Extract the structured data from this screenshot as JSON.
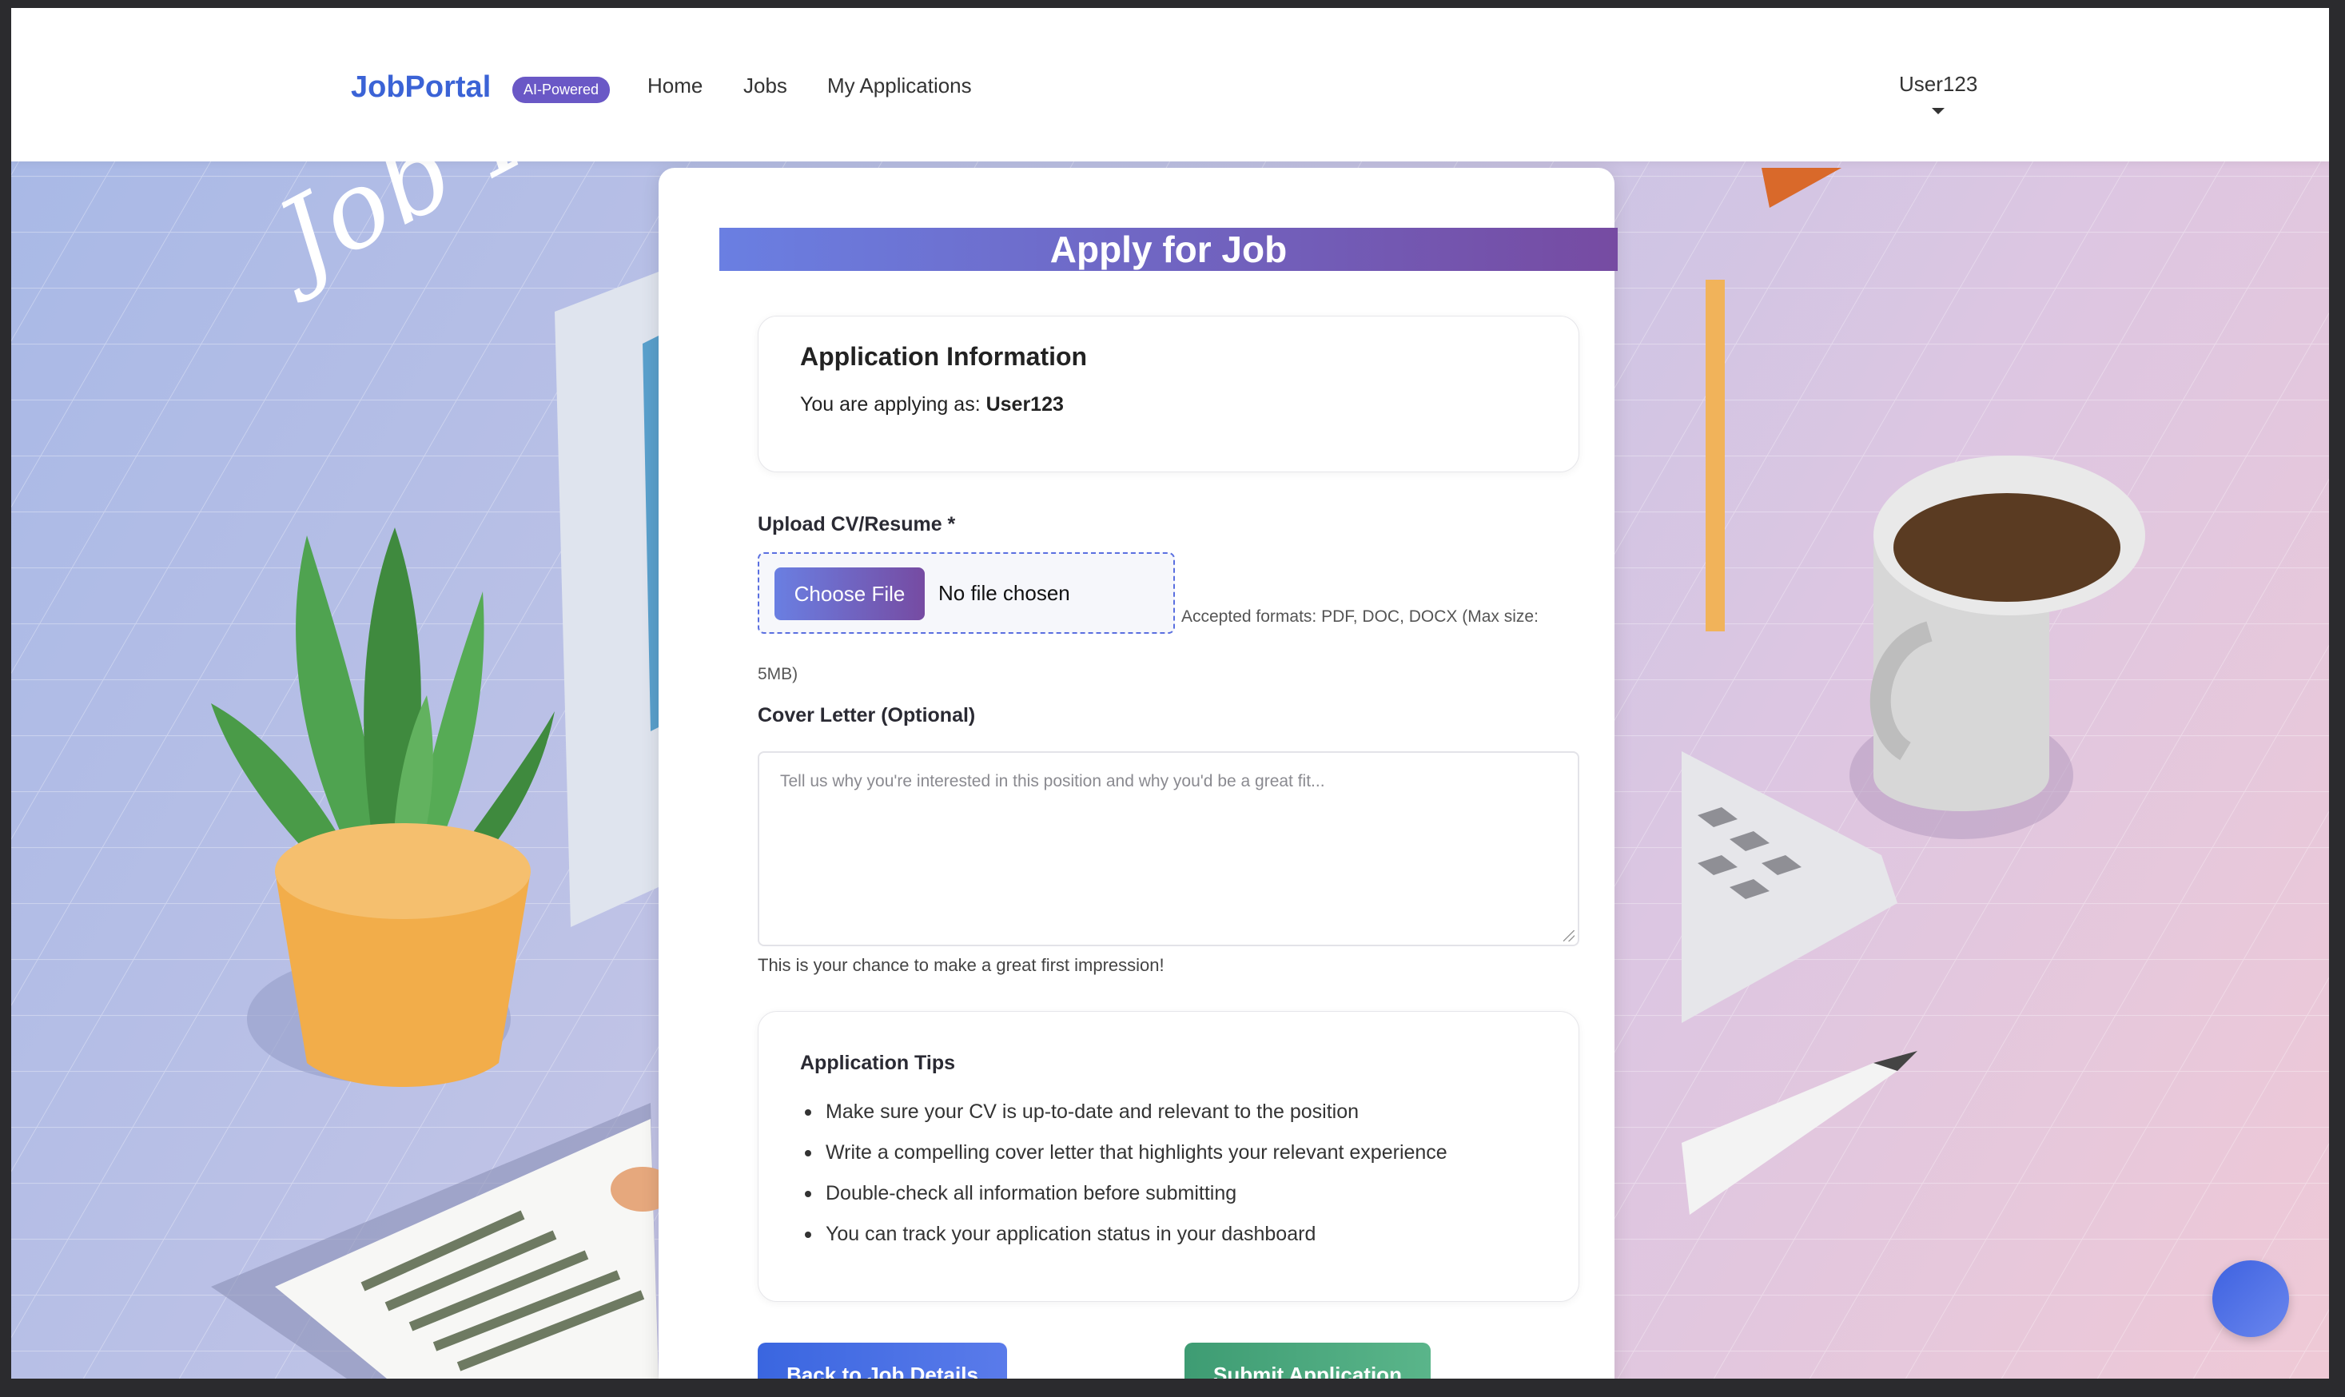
{
  "header": {
    "brand": "JobPortal",
    "badge": "AI-Powered",
    "nav": [
      {
        "label": "Home"
      },
      {
        "label": "Jobs"
      },
      {
        "label": "My Applications"
      }
    ],
    "user": "User123"
  },
  "background": {
    "handwriting": "Job Hunting"
  },
  "form": {
    "title": "Apply for Job",
    "info": {
      "heading": "Application Information",
      "applying_prefix": "You are applying as:",
      "username": "User123"
    },
    "cv": {
      "label": "Upload CV/Resume *",
      "button": "Choose File",
      "status": "No file chosen",
      "hint": "Accepted formats: PDF, DOC, DOCX (Max size: 5MB)"
    },
    "cover": {
      "label": "Cover Letter (Optional)",
      "placeholder": "Tell us why you're interested in this position and why you'd be a great fit...",
      "help": "This is your chance to make a great first impression!"
    },
    "tips": {
      "heading": "Application Tips",
      "items": [
        "Make sure your CV is up-to-date and relevant to the position",
        "Write a compelling cover letter that highlights your relevant experience",
        "Double-check all information before submitting",
        "You can track your application status in your dashboard"
      ]
    },
    "buttons": {
      "back": "Back to Job Details",
      "submit": "Submit Application"
    }
  },
  "colors": {
    "brand": "#3b63d6",
    "accent_gradient_start": "#6a7fe2",
    "accent_gradient_end": "#764ba2",
    "submit": "#3e9c73"
  }
}
